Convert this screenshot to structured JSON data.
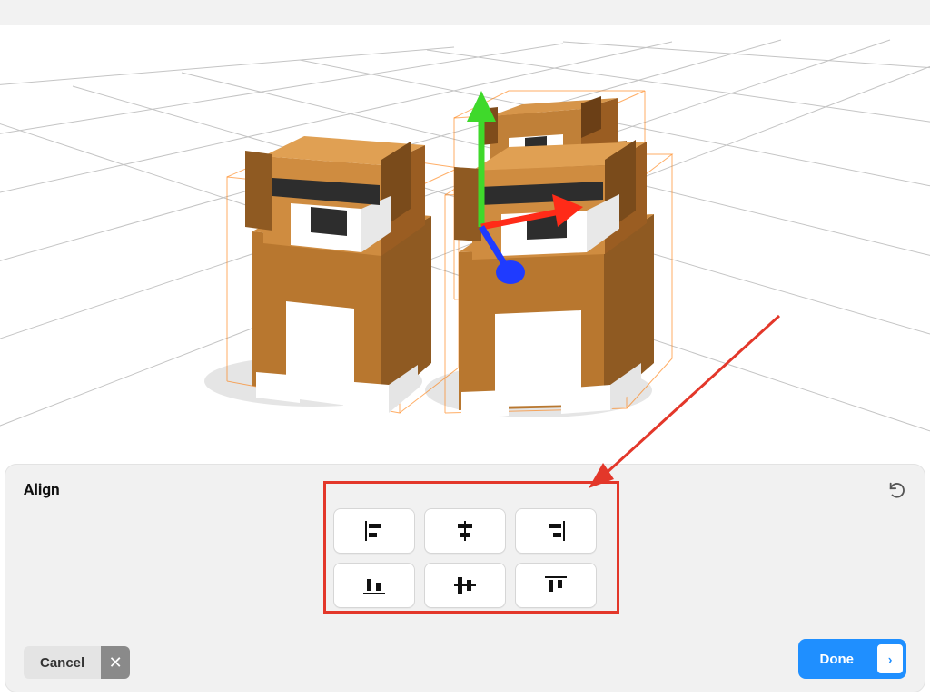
{
  "panel": {
    "title": "Align",
    "cancel_label": "Cancel",
    "done_label": "Done"
  },
  "align_buttons": {
    "row1": [
      "align-left",
      "align-h-center",
      "align-right"
    ],
    "row2": [
      "align-bottom",
      "align-v-center",
      "align-top"
    ]
  },
  "icons": {
    "undo": "undo-icon",
    "close": "close-icon",
    "next": "chevron-right-icon"
  },
  "gizmo": {
    "axes": {
      "x": "#ff2b18",
      "y": "#3fd92b",
      "z": "#1f3bff"
    }
  },
  "annotation": {
    "highlight": "align-buttons-group",
    "arrow_color": "#e3372a"
  },
  "scene": {
    "models": [
      {
        "name": "dog-left",
        "selected": true
      },
      {
        "name": "dog-front",
        "selected": true
      },
      {
        "name": "dog-back",
        "selected": true
      }
    ],
    "grid_color": "#bcbcbc"
  },
  "colors": {
    "panel_bg": "#f1f1f1",
    "primary": "#1f8fff",
    "button_bg": "#ffffff",
    "button_border": "#d6d6d6",
    "dog_body": "#b8772f",
    "dog_white": "#ffffff",
    "dog_dark": "#2d2d2d"
  }
}
